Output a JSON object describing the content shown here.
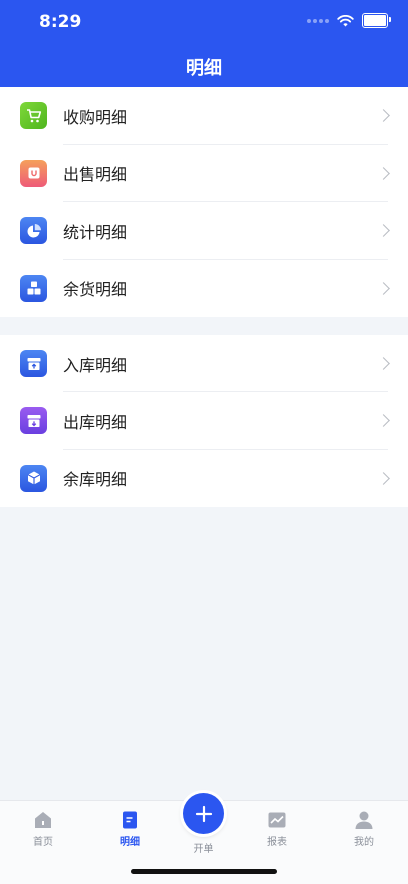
{
  "status": {
    "time": "8:29"
  },
  "header": {
    "title": "明细"
  },
  "colors": {
    "primary": "#2b56f0",
    "background": "#f2f5f9"
  },
  "menu_groups": [
    {
      "items": [
        {
          "label": "收购明细",
          "icon": "cart-icon",
          "color": "#6ccc2c"
        },
        {
          "label": "出售明细",
          "icon": "bag-icon",
          "color": "#f47a56"
        },
        {
          "label": "统计明细",
          "icon": "pie-chart-icon",
          "color": "#3e72ec"
        },
        {
          "label": "余货明细",
          "icon": "boxes-icon",
          "color": "#3e72ec"
        }
      ]
    },
    {
      "items": [
        {
          "label": "入库明细",
          "icon": "inbox-in-icon",
          "color": "#3e72ec"
        },
        {
          "label": "出库明细",
          "icon": "inbox-out-icon",
          "color": "#7a4fe6"
        },
        {
          "label": "余库明细",
          "icon": "cube-icon",
          "color": "#3e72ec"
        }
      ]
    }
  ],
  "tabbar": {
    "home": "首页",
    "detail": "明细",
    "create": "开单",
    "report": "报表",
    "mine": "我的"
  }
}
